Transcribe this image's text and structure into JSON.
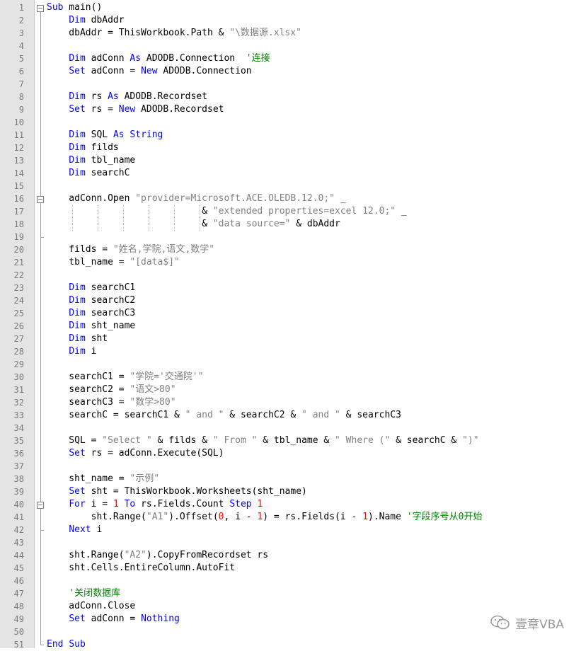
{
  "lines": [
    [
      {
        "t": "kw",
        "v": "Sub"
      },
      {
        "t": "plain",
        "v": " main()"
      }
    ],
    [
      {
        "t": "plain",
        "v": "    "
      },
      {
        "t": "kw",
        "v": "Dim"
      },
      {
        "t": "plain",
        "v": " dbAddr"
      }
    ],
    [
      {
        "t": "plain",
        "v": "    dbAddr = ThisWorkbook.Path & "
      },
      {
        "t": "str",
        "v": "\"\\数据源.xlsx\""
      }
    ],
    [],
    [
      {
        "t": "plain",
        "v": "    "
      },
      {
        "t": "kw",
        "v": "Dim"
      },
      {
        "t": "plain",
        "v": " adConn "
      },
      {
        "t": "kw",
        "v": "As"
      },
      {
        "t": "plain",
        "v": " ADODB.Connection  "
      },
      {
        "t": "cmt",
        "v": "'连接"
      }
    ],
    [
      {
        "t": "plain",
        "v": "    "
      },
      {
        "t": "kw",
        "v": "Set"
      },
      {
        "t": "plain",
        "v": " adConn = "
      },
      {
        "t": "kw",
        "v": "New"
      },
      {
        "t": "plain",
        "v": " ADODB.Connection"
      }
    ],
    [],
    [
      {
        "t": "plain",
        "v": "    "
      },
      {
        "t": "kw",
        "v": "Dim"
      },
      {
        "t": "plain",
        "v": " rs "
      },
      {
        "t": "kw",
        "v": "As"
      },
      {
        "t": "plain",
        "v": " ADODB.Recordset"
      }
    ],
    [
      {
        "t": "plain",
        "v": "    "
      },
      {
        "t": "kw",
        "v": "Set"
      },
      {
        "t": "plain",
        "v": " rs = "
      },
      {
        "t": "kw",
        "v": "New"
      },
      {
        "t": "plain",
        "v": " ADODB.Recordset"
      }
    ],
    [],
    [
      {
        "t": "plain",
        "v": "    "
      },
      {
        "t": "kw",
        "v": "Dim"
      },
      {
        "t": "plain",
        "v": " SQL "
      },
      {
        "t": "kw",
        "v": "As"
      },
      {
        "t": "plain",
        "v": " "
      },
      {
        "t": "kw",
        "v": "String"
      }
    ],
    [
      {
        "t": "plain",
        "v": "    "
      },
      {
        "t": "kw",
        "v": "Dim"
      },
      {
        "t": "plain",
        "v": " filds"
      }
    ],
    [
      {
        "t": "plain",
        "v": "    "
      },
      {
        "t": "kw",
        "v": "Dim"
      },
      {
        "t": "plain",
        "v": " tbl_name"
      }
    ],
    [
      {
        "t": "plain",
        "v": "    "
      },
      {
        "t": "kw",
        "v": "Dim"
      },
      {
        "t": "plain",
        "v": " searchC"
      }
    ],
    [],
    [
      {
        "t": "plain",
        "v": "    adConn.Open "
      },
      {
        "t": "str",
        "v": "\"provider=Microsoft.ACE.OLEDB.12.0;\""
      },
      {
        "t": "plain",
        "v": " _"
      }
    ],
    [
      {
        "t": "plain",
        "v": "                            & "
      },
      {
        "t": "str",
        "v": "\"extended properties=excel 12.0;\""
      },
      {
        "t": "plain",
        "v": " _"
      }
    ],
    [
      {
        "t": "plain",
        "v": "                            & "
      },
      {
        "t": "str",
        "v": "\"data source=\""
      },
      {
        "t": "plain",
        "v": " & dbAddr"
      }
    ],
    [],
    [
      {
        "t": "plain",
        "v": "    filds = "
      },
      {
        "t": "str",
        "v": "\"姓名,学院,语文,数学\""
      }
    ],
    [
      {
        "t": "plain",
        "v": "    tbl_name = "
      },
      {
        "t": "str",
        "v": "\"[data$]\""
      }
    ],
    [],
    [
      {
        "t": "plain",
        "v": "    "
      },
      {
        "t": "kw",
        "v": "Dim"
      },
      {
        "t": "plain",
        "v": " searchC1"
      }
    ],
    [
      {
        "t": "plain",
        "v": "    "
      },
      {
        "t": "kw",
        "v": "Dim"
      },
      {
        "t": "plain",
        "v": " searchC2"
      }
    ],
    [
      {
        "t": "plain",
        "v": "    "
      },
      {
        "t": "kw",
        "v": "Dim"
      },
      {
        "t": "plain",
        "v": " searchC3"
      }
    ],
    [
      {
        "t": "plain",
        "v": "    "
      },
      {
        "t": "kw",
        "v": "Dim"
      },
      {
        "t": "plain",
        "v": " sht_name"
      }
    ],
    [
      {
        "t": "plain",
        "v": "    "
      },
      {
        "t": "kw",
        "v": "Dim"
      },
      {
        "t": "plain",
        "v": " sht"
      }
    ],
    [
      {
        "t": "plain",
        "v": "    "
      },
      {
        "t": "kw",
        "v": "Dim"
      },
      {
        "t": "plain",
        "v": " i"
      }
    ],
    [],
    [
      {
        "t": "plain",
        "v": "    searchC1 = "
      },
      {
        "t": "str",
        "v": "\"学院='交通院'\""
      }
    ],
    [
      {
        "t": "plain",
        "v": "    searchC2 = "
      },
      {
        "t": "str",
        "v": "\"语文>80\""
      }
    ],
    [
      {
        "t": "plain",
        "v": "    searchC3 = "
      },
      {
        "t": "str",
        "v": "\"数学>80\""
      }
    ],
    [
      {
        "t": "plain",
        "v": "    searchC = searchC1 & "
      },
      {
        "t": "str",
        "v": "\" and \""
      },
      {
        "t": "plain",
        "v": " & searchC2 & "
      },
      {
        "t": "str",
        "v": "\" and \""
      },
      {
        "t": "plain",
        "v": " & searchC3"
      }
    ],
    [],
    [
      {
        "t": "plain",
        "v": "    SQL = "
      },
      {
        "t": "str",
        "v": "\"Select \""
      },
      {
        "t": "plain",
        "v": " & filds & "
      },
      {
        "t": "str",
        "v": "\" From \""
      },
      {
        "t": "plain",
        "v": " & tbl_name & "
      },
      {
        "t": "str",
        "v": "\" Where (\""
      },
      {
        "t": "plain",
        "v": " & searchC & "
      },
      {
        "t": "str",
        "v": "\")\""
      }
    ],
    [
      {
        "t": "plain",
        "v": "    "
      },
      {
        "t": "kw",
        "v": "Set"
      },
      {
        "t": "plain",
        "v": " rs = adConn.Execute(SQL)"
      }
    ],
    [],
    [
      {
        "t": "plain",
        "v": "    sht_name = "
      },
      {
        "t": "str",
        "v": "\"示例\""
      }
    ],
    [
      {
        "t": "plain",
        "v": "    "
      },
      {
        "t": "kw",
        "v": "Set"
      },
      {
        "t": "plain",
        "v": " sht = ThisWorkbook.Worksheets(sht_name)"
      }
    ],
    [
      {
        "t": "plain",
        "v": "    "
      },
      {
        "t": "kw",
        "v": "For"
      },
      {
        "t": "plain",
        "v": " i = "
      },
      {
        "t": "num",
        "v": "1"
      },
      {
        "t": "plain",
        "v": " "
      },
      {
        "t": "kw",
        "v": "To"
      },
      {
        "t": "plain",
        "v": " rs.Fields.Count "
      },
      {
        "t": "kw",
        "v": "Step"
      },
      {
        "t": "plain",
        "v": " "
      },
      {
        "t": "num",
        "v": "1"
      }
    ],
    [
      {
        "t": "plain",
        "v": "        sht.Range("
      },
      {
        "t": "str",
        "v": "\"A1\""
      },
      {
        "t": "plain",
        "v": ").Offset("
      },
      {
        "t": "num",
        "v": "0"
      },
      {
        "t": "plain",
        "v": ", i - "
      },
      {
        "t": "num",
        "v": "1"
      },
      {
        "t": "plain",
        "v": ") = rs.Fields(i - "
      },
      {
        "t": "num",
        "v": "1"
      },
      {
        "t": "plain",
        "v": ").Name "
      },
      {
        "t": "cmt",
        "v": "'字段序号从0开始"
      }
    ],
    [
      {
        "t": "plain",
        "v": "    "
      },
      {
        "t": "kw",
        "v": "Next"
      },
      {
        "t": "plain",
        "v": " i"
      }
    ],
    [],
    [
      {
        "t": "plain",
        "v": "    sht.Range("
      },
      {
        "t": "str",
        "v": "\"A2\""
      },
      {
        "t": "plain",
        "v": ").CopyFromRecordset rs"
      }
    ],
    [
      {
        "t": "plain",
        "v": "    sht.Cells.EntireColumn.AutoFit"
      }
    ],
    [],
    [
      {
        "t": "plain",
        "v": "    "
      },
      {
        "t": "cmt",
        "v": "'关闭数据库"
      }
    ],
    [
      {
        "t": "plain",
        "v": "    adConn.Close"
      }
    ],
    [
      {
        "t": "plain",
        "v": "    "
      },
      {
        "t": "kw",
        "v": "Set"
      },
      {
        "t": "plain",
        "v": " adConn = "
      },
      {
        "t": "kw",
        "v": "Nothing"
      }
    ],
    [],
    [
      {
        "t": "kw",
        "v": "End"
      },
      {
        "t": "plain",
        "v": " "
      },
      {
        "t": "kw",
        "v": "Sub"
      }
    ]
  ],
  "watermark": {
    "text": "壹章VBA",
    "icon": "wechat-icon"
  },
  "colors": {
    "keyword": "#0000ff",
    "string": "#808080",
    "number": "#ff0000",
    "comment": "#008000",
    "gutter": "#e4e4e4"
  }
}
